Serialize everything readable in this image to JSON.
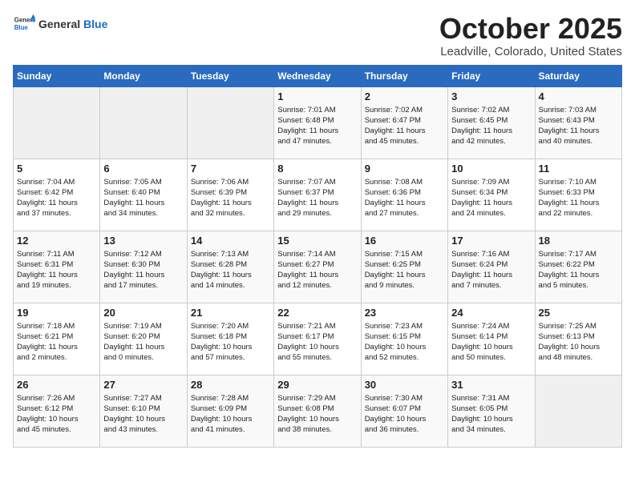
{
  "header": {
    "logo_general": "General",
    "logo_blue": "Blue",
    "month_title": "October 2025",
    "location": "Leadville, Colorado, United States"
  },
  "days_of_week": [
    "Sunday",
    "Monday",
    "Tuesday",
    "Wednesday",
    "Thursday",
    "Friday",
    "Saturday"
  ],
  "weeks": [
    [
      {
        "day": "",
        "info": ""
      },
      {
        "day": "",
        "info": ""
      },
      {
        "day": "",
        "info": ""
      },
      {
        "day": "1",
        "info": "Sunrise: 7:01 AM\nSunset: 6:48 PM\nDaylight: 11 hours\nand 47 minutes."
      },
      {
        "day": "2",
        "info": "Sunrise: 7:02 AM\nSunset: 6:47 PM\nDaylight: 11 hours\nand 45 minutes."
      },
      {
        "day": "3",
        "info": "Sunrise: 7:02 AM\nSunset: 6:45 PM\nDaylight: 11 hours\nand 42 minutes."
      },
      {
        "day": "4",
        "info": "Sunrise: 7:03 AM\nSunset: 6:43 PM\nDaylight: 11 hours\nand 40 minutes."
      }
    ],
    [
      {
        "day": "5",
        "info": "Sunrise: 7:04 AM\nSunset: 6:42 PM\nDaylight: 11 hours\nand 37 minutes."
      },
      {
        "day": "6",
        "info": "Sunrise: 7:05 AM\nSunset: 6:40 PM\nDaylight: 11 hours\nand 34 minutes."
      },
      {
        "day": "7",
        "info": "Sunrise: 7:06 AM\nSunset: 6:39 PM\nDaylight: 11 hours\nand 32 minutes."
      },
      {
        "day": "8",
        "info": "Sunrise: 7:07 AM\nSunset: 6:37 PM\nDaylight: 11 hours\nand 29 minutes."
      },
      {
        "day": "9",
        "info": "Sunrise: 7:08 AM\nSunset: 6:36 PM\nDaylight: 11 hours\nand 27 minutes."
      },
      {
        "day": "10",
        "info": "Sunrise: 7:09 AM\nSunset: 6:34 PM\nDaylight: 11 hours\nand 24 minutes."
      },
      {
        "day": "11",
        "info": "Sunrise: 7:10 AM\nSunset: 6:33 PM\nDaylight: 11 hours\nand 22 minutes."
      }
    ],
    [
      {
        "day": "12",
        "info": "Sunrise: 7:11 AM\nSunset: 6:31 PM\nDaylight: 11 hours\nand 19 minutes."
      },
      {
        "day": "13",
        "info": "Sunrise: 7:12 AM\nSunset: 6:30 PM\nDaylight: 11 hours\nand 17 minutes."
      },
      {
        "day": "14",
        "info": "Sunrise: 7:13 AM\nSunset: 6:28 PM\nDaylight: 11 hours\nand 14 minutes."
      },
      {
        "day": "15",
        "info": "Sunrise: 7:14 AM\nSunset: 6:27 PM\nDaylight: 11 hours\nand 12 minutes."
      },
      {
        "day": "16",
        "info": "Sunrise: 7:15 AM\nSunset: 6:25 PM\nDaylight: 11 hours\nand 9 minutes."
      },
      {
        "day": "17",
        "info": "Sunrise: 7:16 AM\nSunset: 6:24 PM\nDaylight: 11 hours\nand 7 minutes."
      },
      {
        "day": "18",
        "info": "Sunrise: 7:17 AM\nSunset: 6:22 PM\nDaylight: 11 hours\nand 5 minutes."
      }
    ],
    [
      {
        "day": "19",
        "info": "Sunrise: 7:18 AM\nSunset: 6:21 PM\nDaylight: 11 hours\nand 2 minutes."
      },
      {
        "day": "20",
        "info": "Sunrise: 7:19 AM\nSunset: 6:20 PM\nDaylight: 11 hours\nand 0 minutes."
      },
      {
        "day": "21",
        "info": "Sunrise: 7:20 AM\nSunset: 6:18 PM\nDaylight: 10 hours\nand 57 minutes."
      },
      {
        "day": "22",
        "info": "Sunrise: 7:21 AM\nSunset: 6:17 PM\nDaylight: 10 hours\nand 55 minutes."
      },
      {
        "day": "23",
        "info": "Sunrise: 7:23 AM\nSunset: 6:15 PM\nDaylight: 10 hours\nand 52 minutes."
      },
      {
        "day": "24",
        "info": "Sunrise: 7:24 AM\nSunset: 6:14 PM\nDaylight: 10 hours\nand 50 minutes."
      },
      {
        "day": "25",
        "info": "Sunrise: 7:25 AM\nSunset: 6:13 PM\nDaylight: 10 hours\nand 48 minutes."
      }
    ],
    [
      {
        "day": "26",
        "info": "Sunrise: 7:26 AM\nSunset: 6:12 PM\nDaylight: 10 hours\nand 45 minutes."
      },
      {
        "day": "27",
        "info": "Sunrise: 7:27 AM\nSunset: 6:10 PM\nDaylight: 10 hours\nand 43 minutes."
      },
      {
        "day": "28",
        "info": "Sunrise: 7:28 AM\nSunset: 6:09 PM\nDaylight: 10 hours\nand 41 minutes."
      },
      {
        "day": "29",
        "info": "Sunrise: 7:29 AM\nSunset: 6:08 PM\nDaylight: 10 hours\nand 38 minutes."
      },
      {
        "day": "30",
        "info": "Sunrise: 7:30 AM\nSunset: 6:07 PM\nDaylight: 10 hours\nand 36 minutes."
      },
      {
        "day": "31",
        "info": "Sunrise: 7:31 AM\nSunset: 6:05 PM\nDaylight: 10 hours\nand 34 minutes."
      },
      {
        "day": "",
        "info": ""
      }
    ]
  ]
}
